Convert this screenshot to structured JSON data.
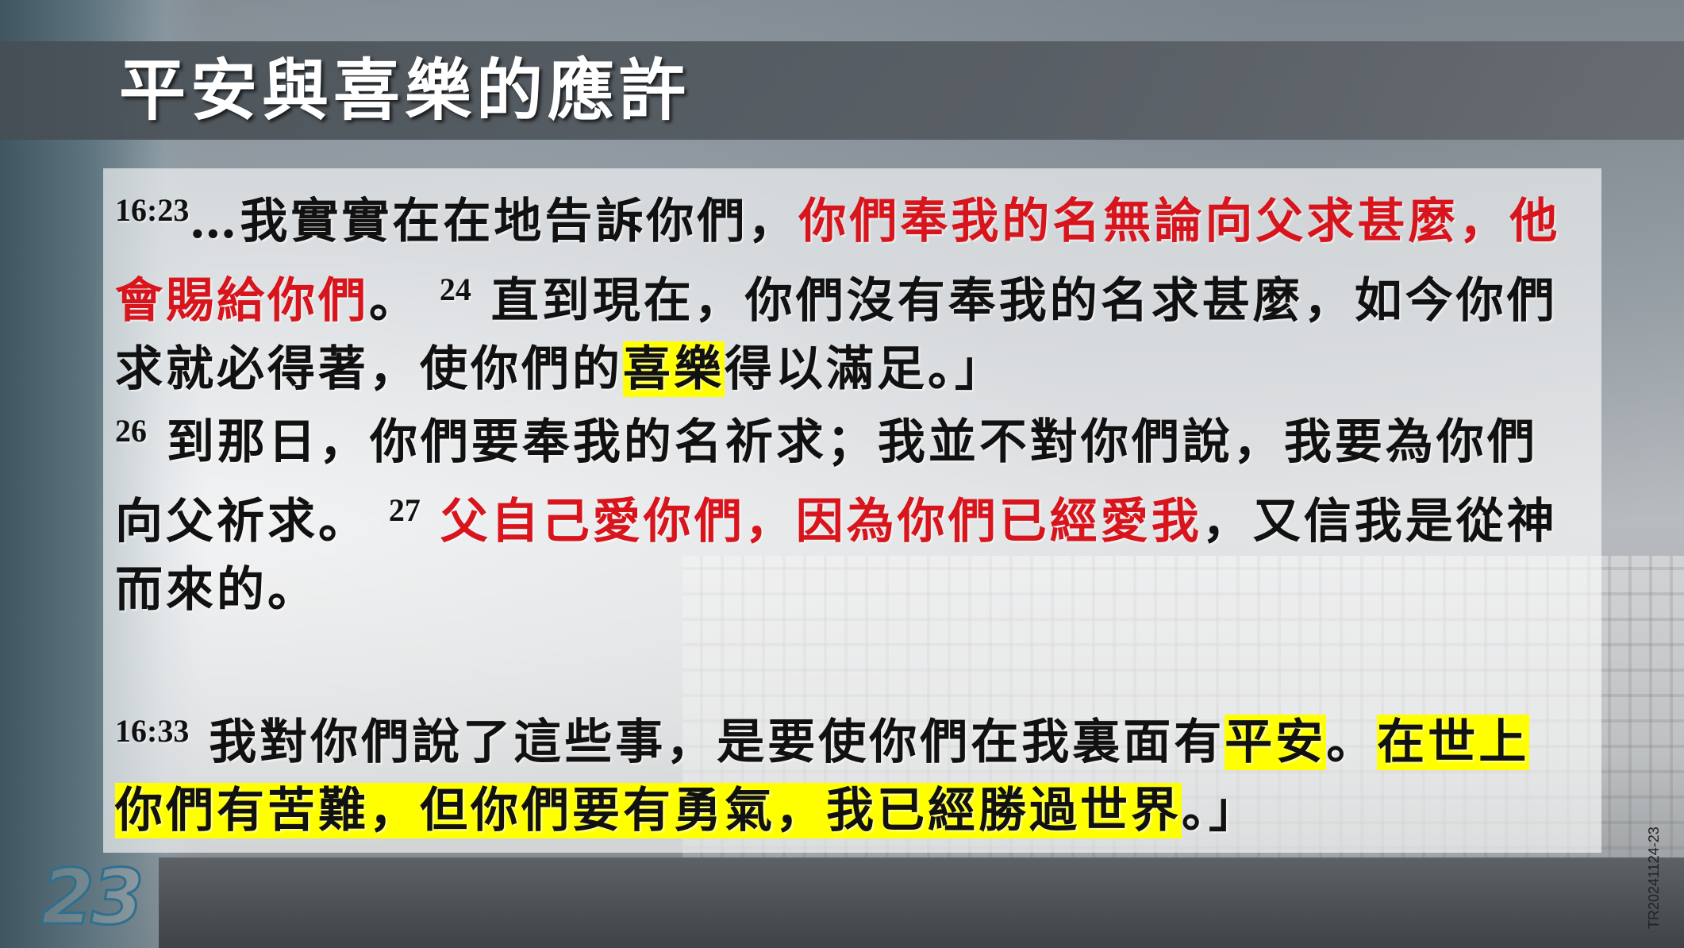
{
  "slide": {
    "title": "平安與喜樂的應許",
    "slide_number": "23",
    "slide_code": "TR20241124-23"
  },
  "passage1": {
    "ref": "16:23",
    "t1": "…我實實在在地告訴你們，",
    "t2_red": "你們奉我的名無論向父求甚麼，他會賜給你們",
    "t3": "。 ",
    "v24": "24",
    "t4": " 直到現在，你們沒有奉我的名求甚麼，如今你們求就必得著，使你們的",
    "t5_highlight": "喜樂",
    "t6": "得以滿足。」"
  },
  "passage2": {
    "v26": "26",
    "t1": " 到那日，你們要奉我的名祈求；我並不對你們說，我要為你們向父祈求。 ",
    "v27": "27",
    "t2_red": " 父自己愛你們，因為你們已經愛我",
    "t3": "，又信我是從神而來的。"
  },
  "passage3": {
    "ref": "16:33",
    "t1": " 我對你們說了這些事，是要使你們在我裏面有",
    "t2_highlight": "平安",
    "t3": "。",
    "t4_highlight": "在世上你們有苦難，但你們要有勇氣，我已經勝過世界",
    "t5": "。」"
  },
  "colors": {
    "red_text": "#d8141c",
    "highlight": "#ffff00"
  }
}
